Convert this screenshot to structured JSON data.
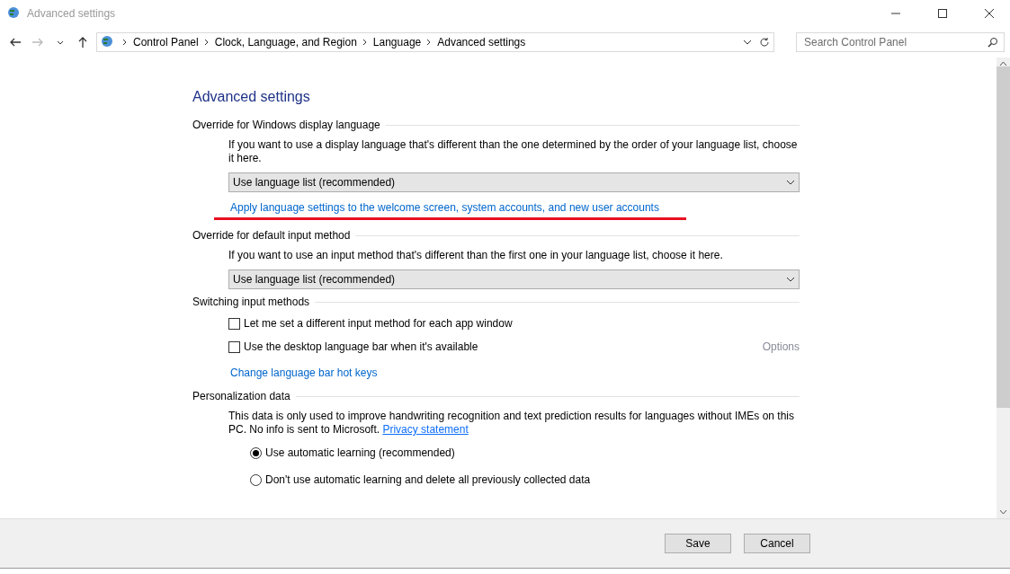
{
  "window": {
    "title": "Advanced settings"
  },
  "nav_buttons": [
    {
      "kind": "back",
      "disabled": false
    },
    {
      "kind": "forward",
      "disabled": true
    },
    {
      "kind": "recent",
      "disabled": false
    },
    {
      "kind": "up",
      "disabled": false
    }
  ],
  "breadcrumbs": [
    "Control Panel",
    "Clock, Language, and Region",
    "Language",
    "Advanced settings"
  ],
  "search": {
    "placeholder": "Search Control Panel"
  },
  "page_title": "Advanced settings",
  "sections": [
    {
      "heading": "Override for Windows display language",
      "items": [
        {
          "kind": "text",
          "text": "If you want to use a display language that's different than the one determined by the order of your language list, choose it here."
        },
        {
          "kind": "dropdown",
          "value": "Use language list (recommended)"
        },
        {
          "kind": "link",
          "text": "Apply language settings to the welcome screen, system accounts, and new user accounts",
          "highlighted": true
        }
      ]
    },
    {
      "heading": "Override for default input method",
      "items": [
        {
          "kind": "text",
          "text": "If you want to use an input method that's different than the first one in your language list, choose it here."
        },
        {
          "kind": "dropdown",
          "value": "Use language list (recommended)"
        }
      ]
    },
    {
      "heading": "Switching input methods",
      "items": [
        {
          "kind": "checkbox",
          "label": "Let me set a different input method for each app window",
          "checked": false
        },
        {
          "kind": "checkbox",
          "label": "Use the desktop language bar when it's available",
          "checked": false,
          "option": {
            "text": "Options",
            "disabled": true
          }
        },
        {
          "kind": "link",
          "text": "Change language bar hot keys",
          "highlighted": false
        }
      ]
    },
    {
      "heading": "Personalization data",
      "items": [
        {
          "kind": "paragraph",
          "text": "This data is only used to improve handwriting recognition and text prediction results for languages without IMEs on this PC. No info is sent to Microsoft.",
          "link": "Privacy statement"
        },
        {
          "kind": "radio",
          "label": "Use automatic learning (recommended)",
          "selected": true
        },
        {
          "kind": "radio",
          "label": "Don't use automatic learning and delete all previously collected data",
          "selected": false
        }
      ]
    }
  ],
  "buttons": [
    "Save",
    "Cancel"
  ]
}
